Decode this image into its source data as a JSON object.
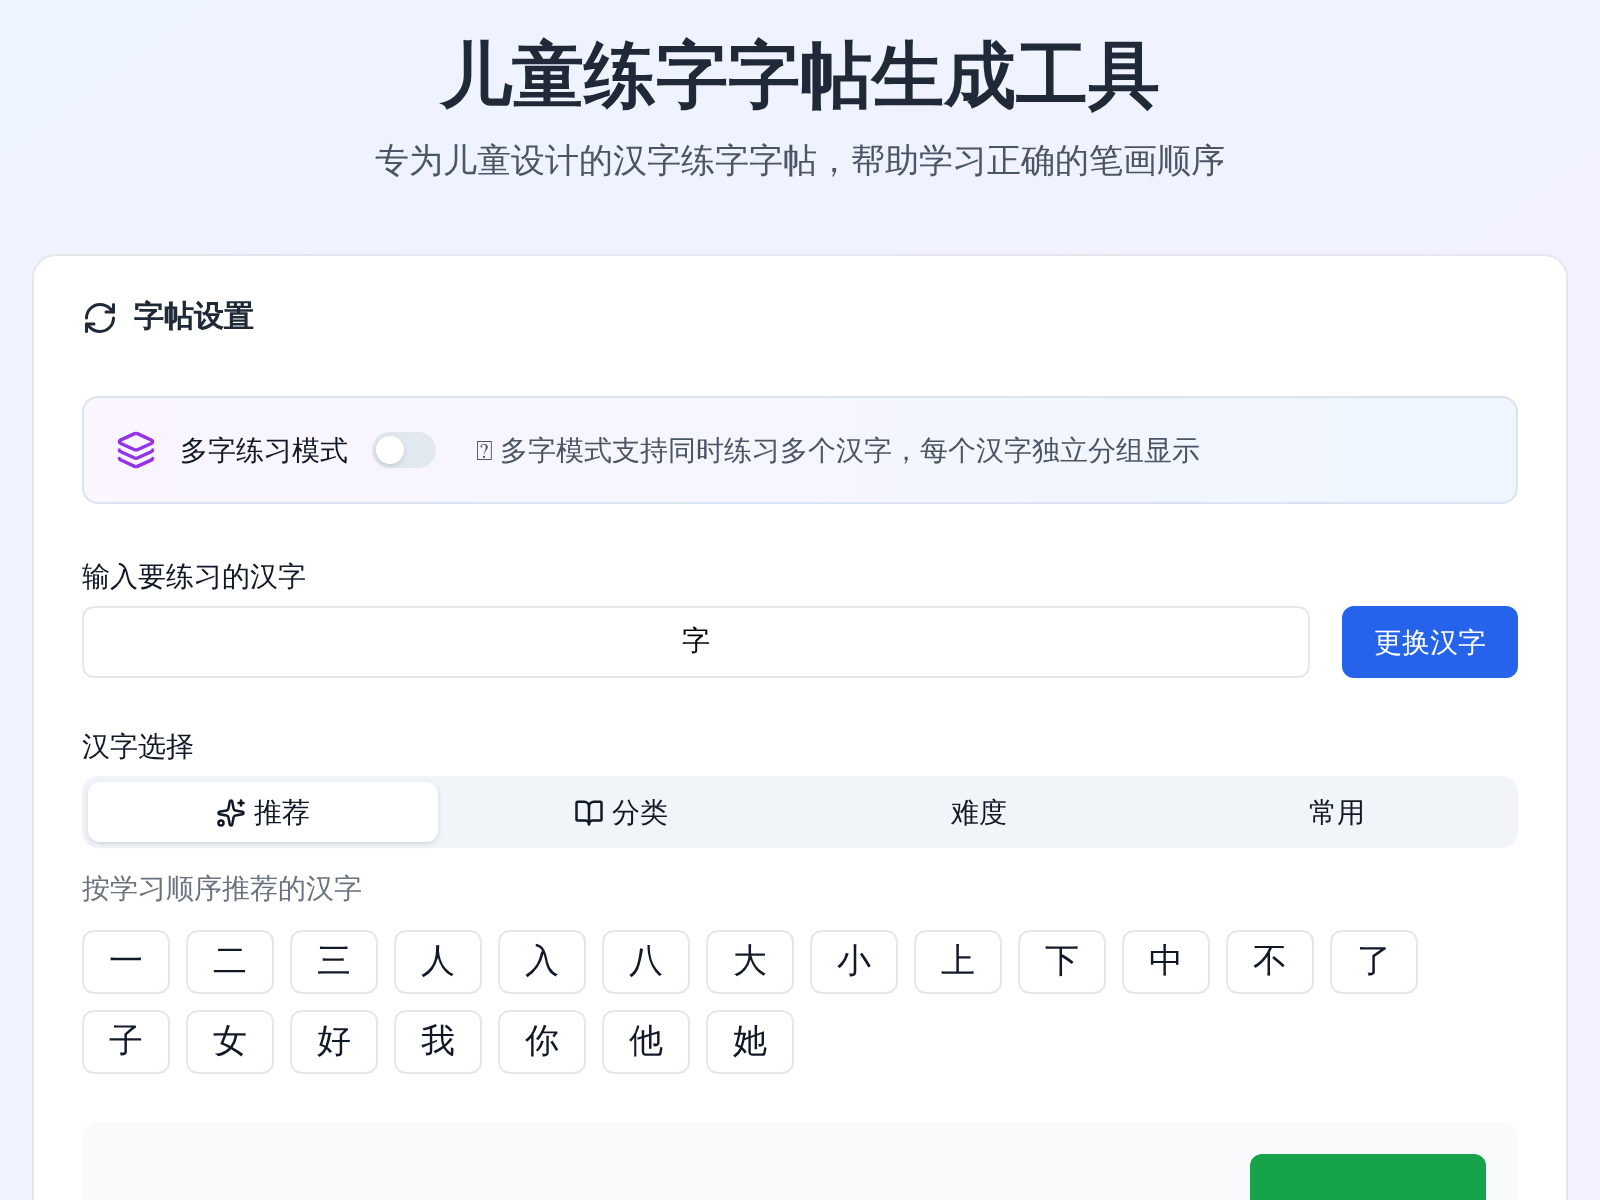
{
  "header": {
    "title": "儿童练字字帖生成工具",
    "subtitle": "专为儿童设计的汉字练字字帖，帮助学习正确的笔画顺序"
  },
  "settings": {
    "title": "字帖设置",
    "multi_mode": {
      "label": "多字练习模式",
      "on": false,
      "hint": "⍰ 多字模式支持同时练习多个汉字，每个汉字独立分组显示"
    },
    "input": {
      "label": "输入要练习的汉字",
      "value": "字",
      "button": "更换汉字"
    },
    "selection": {
      "label": "汉字选择",
      "tabs": [
        {
          "label": "推荐",
          "selected": true
        },
        {
          "label": "分类",
          "selected": false
        },
        {
          "label": "难度",
          "selected": false
        },
        {
          "label": "常用",
          "selected": false
        }
      ],
      "caption": "按学习顺序推荐的汉字",
      "characters": [
        "一",
        "二",
        "三",
        "人",
        "入",
        "八",
        "大",
        "小",
        "上",
        "下",
        "中",
        "不",
        "了",
        "子",
        "女",
        "好",
        "我",
        "你",
        "他",
        "她"
      ]
    }
  }
}
